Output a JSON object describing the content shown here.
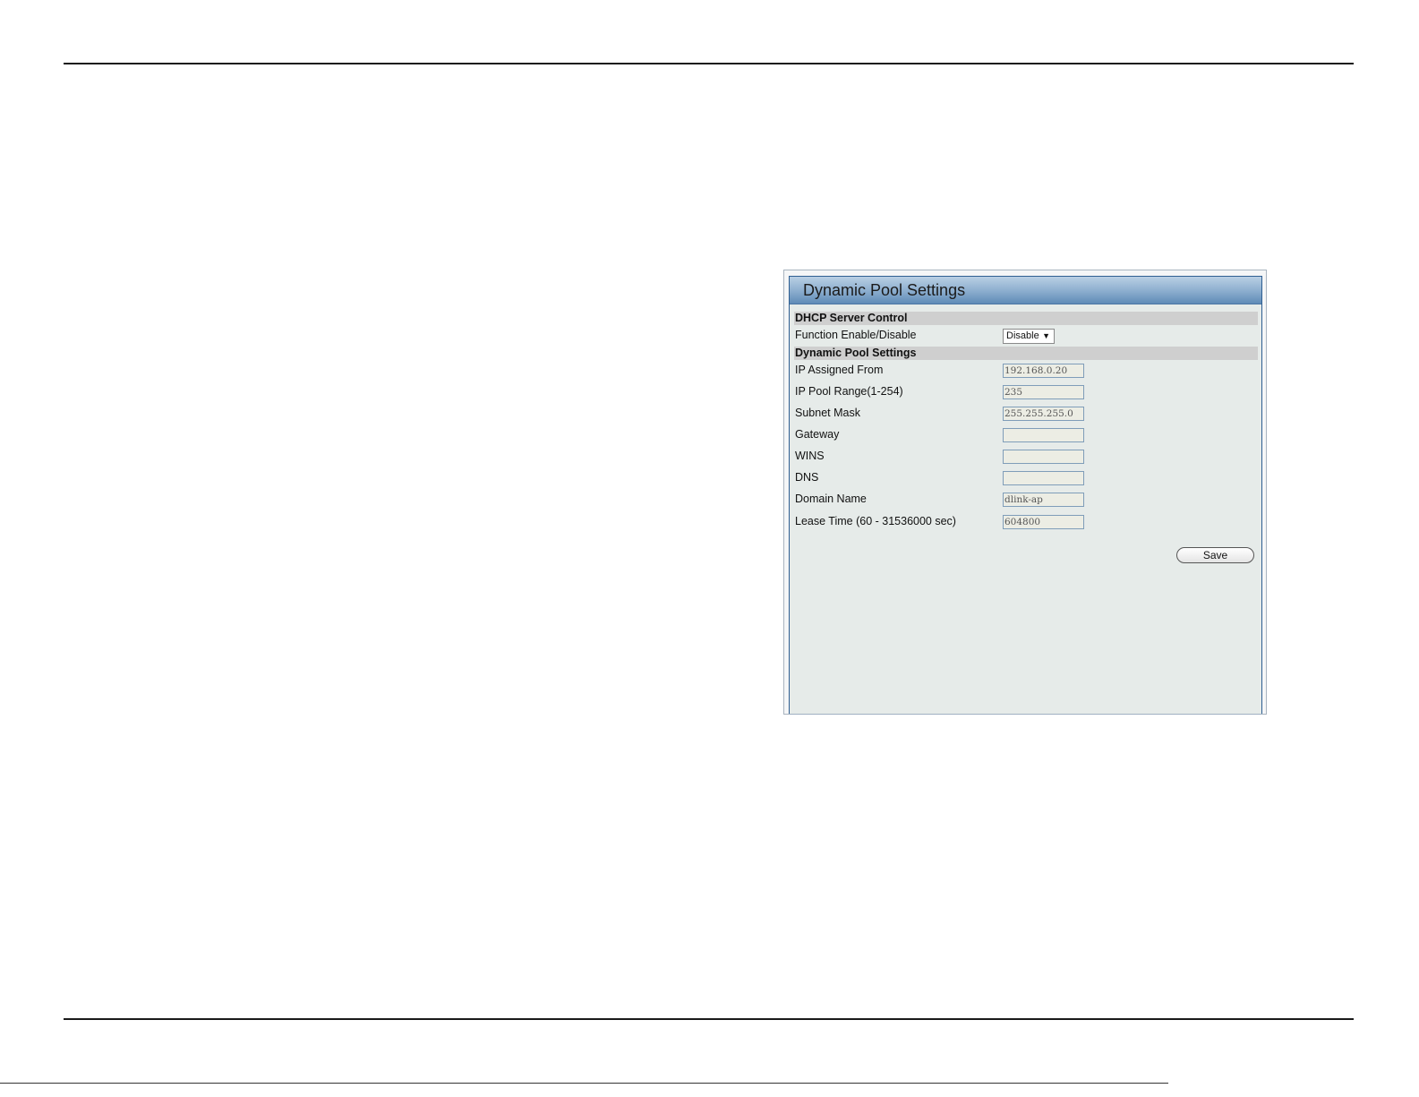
{
  "panel": {
    "title": "Dynamic Pool Settings"
  },
  "dhcp_server_control": {
    "header": "DHCP Server Control",
    "function_label": "Function Enable/Disable",
    "function_value": "Disable"
  },
  "dynamic_pool": {
    "header": "Dynamic Pool Settings",
    "fields": [
      {
        "label": "IP Assigned From",
        "value": "192.168.0.20"
      },
      {
        "label": "IP Pool Range(1-254)",
        "value": "235"
      },
      {
        "label": "Subnet Mask",
        "value": "255.255.255.0"
      },
      {
        "label": "Gateway",
        "value": ""
      },
      {
        "label": "WINS",
        "value": ""
      },
      {
        "label": "DNS",
        "value": ""
      },
      {
        "label": "Domain Name",
        "value": "dlink-ap"
      },
      {
        "label": "Lease Time (60 - 31536000 sec)",
        "value": "604800"
      }
    ]
  },
  "actions": {
    "save_label": "Save"
  },
  "icons": {
    "dropdown": "chevron-down-icon"
  },
  "colors": {
    "panel_border": "#2f5f92",
    "panel_bg": "#e6ebe9",
    "section_bg": "#cfcfcf",
    "field_border": "#7f9db9"
  }
}
